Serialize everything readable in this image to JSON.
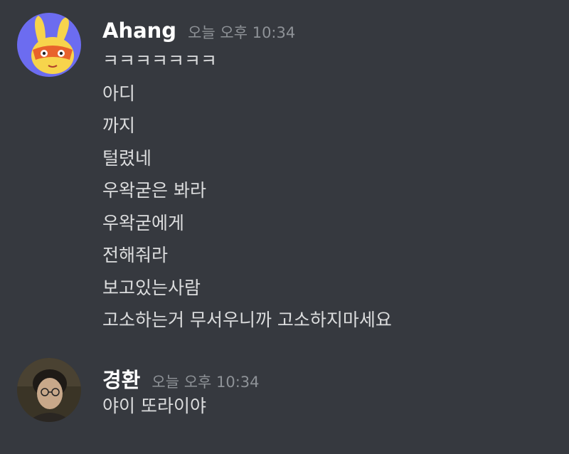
{
  "messages": [
    {
      "author": "Ahang",
      "timestamp": "오늘 오후 10:34",
      "avatar_icon": "bunny-mascot-avatar",
      "lines": [
        "ㅋㅋㅋㅋㅋㅋㅋ",
        "아디",
        "까지",
        "털렸네",
        "우왁굳은 봐라",
        "우왁굳에게",
        "전해줘라",
        "보고있는사람",
        "고소하는거 무서우니까 고소하지마세요"
      ]
    },
    {
      "author": "경환",
      "timestamp": "오늘 오후 10:34",
      "avatar_icon": "person-photo-avatar",
      "lines": [
        "야이 또라이야"
      ]
    }
  ]
}
